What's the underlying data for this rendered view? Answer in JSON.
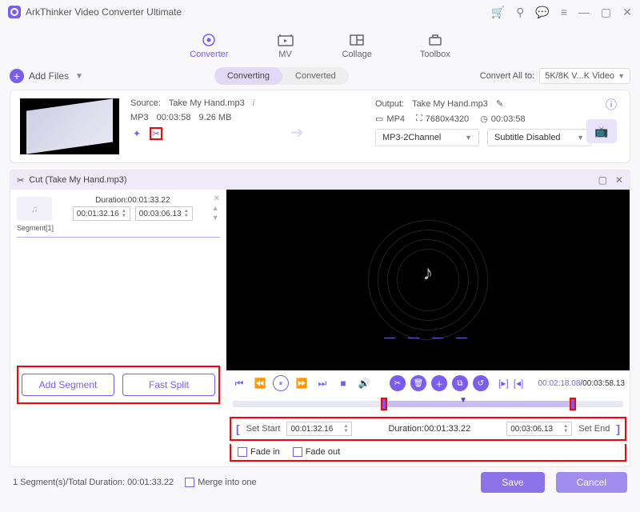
{
  "app": {
    "title": "ArkThinker Video Converter Ultimate"
  },
  "tabs": {
    "converter": "Converter",
    "mv": "MV",
    "collage": "Collage",
    "toolbox": "Toolbox"
  },
  "toolbar": {
    "add_files": "Add Files",
    "converting": "Converting",
    "converted": "Converted",
    "convert_all_to": "Convert All to:",
    "target_format": "5K/8K V...K Video"
  },
  "item": {
    "source_label": "Source:",
    "source_name": "Take My Hand.mp3",
    "codec": "MP3",
    "duration": "00:03:58",
    "size": "9.26 MB",
    "output_label": "Output:",
    "output_name": "Take My Hand.mp3",
    "container": "MP4",
    "resolution": "7680x4320",
    "out_duration": "00:03:58",
    "audio_select": "MP3-2Channel",
    "subtitle_select": "Subtitle Disabled"
  },
  "cut": {
    "title": "Cut (Take My Hand.mp3)",
    "duration_label": "Duration:",
    "duration_value": "00:01:33.22",
    "seg_start": "00:01:32.16",
    "seg_end": "00:03:06.13",
    "segment_label": "Segment[1]",
    "add_segment": "Add Segment",
    "fast_split": "Fast Split",
    "playtime_cur": "00:02:18.08",
    "playtime_total": "00:03:58.13",
    "set_start": "Set Start",
    "set_end": "Set End",
    "row_start": "00:01:32.16",
    "row_duration_label": "Duration:",
    "row_duration": "00:01:33.22",
    "row_end": "00:03:06.13",
    "fade_in": "Fade in",
    "fade_out": "Fade out"
  },
  "footer": {
    "summary": "1 Segment(s)/Total Duration: 00:01:33.22",
    "merge": "Merge into one",
    "save": "Save",
    "cancel": "Cancel"
  }
}
